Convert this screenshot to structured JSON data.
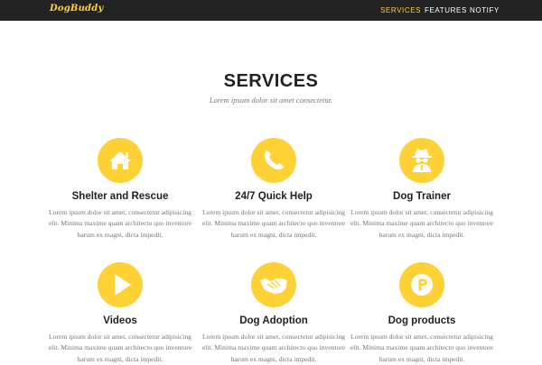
{
  "brand": {
    "logo": "DogBuddy",
    "accent_color": "#fed136",
    "nav_bg": "#232323"
  },
  "nav": {
    "items": [
      {
        "label": "SERVICES",
        "active": true
      },
      {
        "label": "FEATURES",
        "active": false
      },
      {
        "label": "NOTIFY",
        "active": false
      }
    ]
  },
  "services": {
    "title": "SERVICES",
    "subtitle": "Lorem ipsum dolor sit amet consectetur.",
    "items": [
      {
        "title": "Shelter and Rescue",
        "icon": "home-icon",
        "text": "Lorem ipsum dolor sit amet, consectetur adipisicing elit. Minima maxime quam architecto quo inventore harum ex magni, dicta impedit."
      },
      {
        "title": "24/7 Quick Help",
        "icon": "phone-icon",
        "text": "Lorem ipsum dolor sit amet, consectetur adipisicing elit. Minima maxime quam architecto quo inventore harum ex magni, dicta impedit."
      },
      {
        "title": "Dog Trainer",
        "icon": "user-secret-icon",
        "text": "Lorem ipsum dolor sit amet, consectetur adipisicing elit. Minima maxime quam architecto quo inventore harum ex magni, dicta impedit."
      },
      {
        "title": "Videos",
        "icon": "play-icon",
        "text": "Lorem ipsum dolor sit amet, consectetur adipisicing elit. Minima maxime quam architecto quo inventore harum ex magni, dicta impedit."
      },
      {
        "title": "Dog Adoption",
        "icon": "handshake-icon",
        "text": "Lorem ipsum dolor sit amet, consectetur adipisicing elit. Minima maxime quam architecto quo inventore harum ex magni, dicta impedit."
      },
      {
        "title": "Dog products",
        "icon": "product-p-icon",
        "text": "Lorem ipsum dolor sit amet, consectetur adipisicing elit. Minima maxime quam architecto quo inventore harum ex magni, dicta impedit."
      }
    ]
  }
}
